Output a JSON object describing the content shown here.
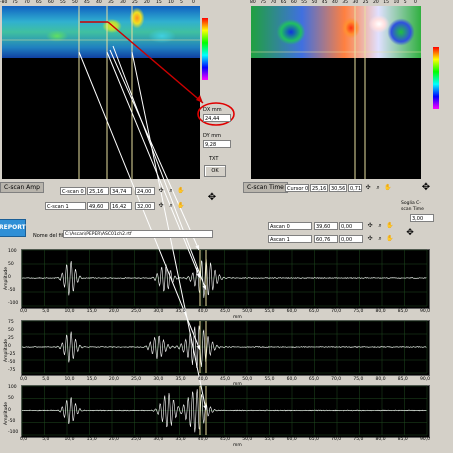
{
  "left_cscan": {
    "x_ticks": [
      "-80",
      "75",
      "70",
      "65",
      "60",
      "55",
      "50",
      "45",
      "40",
      "35",
      "30",
      "25",
      "20",
      "15",
      "10",
      "5",
      "0"
    ],
    "mode_label": "C-scan Amp",
    "cursors": [
      {
        "name": "C-scan 0",
        "v1": "25,16",
        "v2": "34,74",
        "v3": "24,00"
      },
      {
        "name": "C-scan 1",
        "v1": "49,60",
        "v2": "16,42",
        "v3": "32,00"
      }
    ]
  },
  "right_cscan": {
    "x_ticks": [
      "80",
      "75",
      "70",
      "65",
      "60",
      "55",
      "50",
      "45",
      "40",
      "35",
      "30",
      "25",
      "20",
      "15",
      "10",
      "5",
      "0"
    ],
    "mode_label": "C-scan Time",
    "cursor": {
      "name": "Cursor 0",
      "v1": "25,16",
      "v2": "30,56",
      "v3": "0,71"
    }
  },
  "dx": {
    "label": "DX mm",
    "value": "24,44"
  },
  "dy": {
    "label": "DY mm",
    "value": "9,28"
  },
  "txt_label": "TXT",
  "ok_label": "OK",
  "soglia": {
    "label": "Soglia C-scan Time",
    "value": "3,00"
  },
  "ascan_cursors": [
    {
      "name": "Ascan 0",
      "v1": "39,60",
      "v2": "0,00"
    },
    {
      "name": "Ascan 1",
      "v1": "60,76",
      "v2": "0,00"
    }
  ],
  "report_label": "REPORT",
  "file": {
    "label": "Nome del file",
    "value": "C:\\Ascan\\PEPER\\ASC01ch2.rtf"
  },
  "scopes": [
    {
      "y_ticks": [
        "100",
        "50",
        "0",
        "-50",
        "-100"
      ],
      "ylabel": "Amplitude"
    },
    {
      "y_ticks": [
        "75",
        "50",
        "25",
        "0",
        "-25",
        "-50",
        "-75"
      ],
      "ylabel": "Amplitude"
    },
    {
      "y_ticks": [
        "100",
        "50",
        "0",
        "-50",
        "-100"
      ],
      "ylabel": "Amplitude"
    }
  ],
  "x_ticks_ascan": [
    "0,0",
    "5,0",
    "10,0",
    "15,0",
    "20,0",
    "25,0",
    "30,0",
    "35,0",
    "40,0",
    "45,0",
    "50,0",
    "55,0",
    "60,0",
    "65,0",
    "70,0",
    "75,0",
    "80,0",
    "85,0",
    "90,0"
  ],
  "xlabel_ascan": "mm",
  "colors": {
    "panel_bg": "#d4d0c8",
    "trace": "#ffffff",
    "cursor": "#e8e0a0",
    "grid": "#1f4a1f",
    "annotation_arrow": "#ffffff",
    "dx_circle": "#e00000",
    "dx_arrow": "#cc0000"
  }
}
